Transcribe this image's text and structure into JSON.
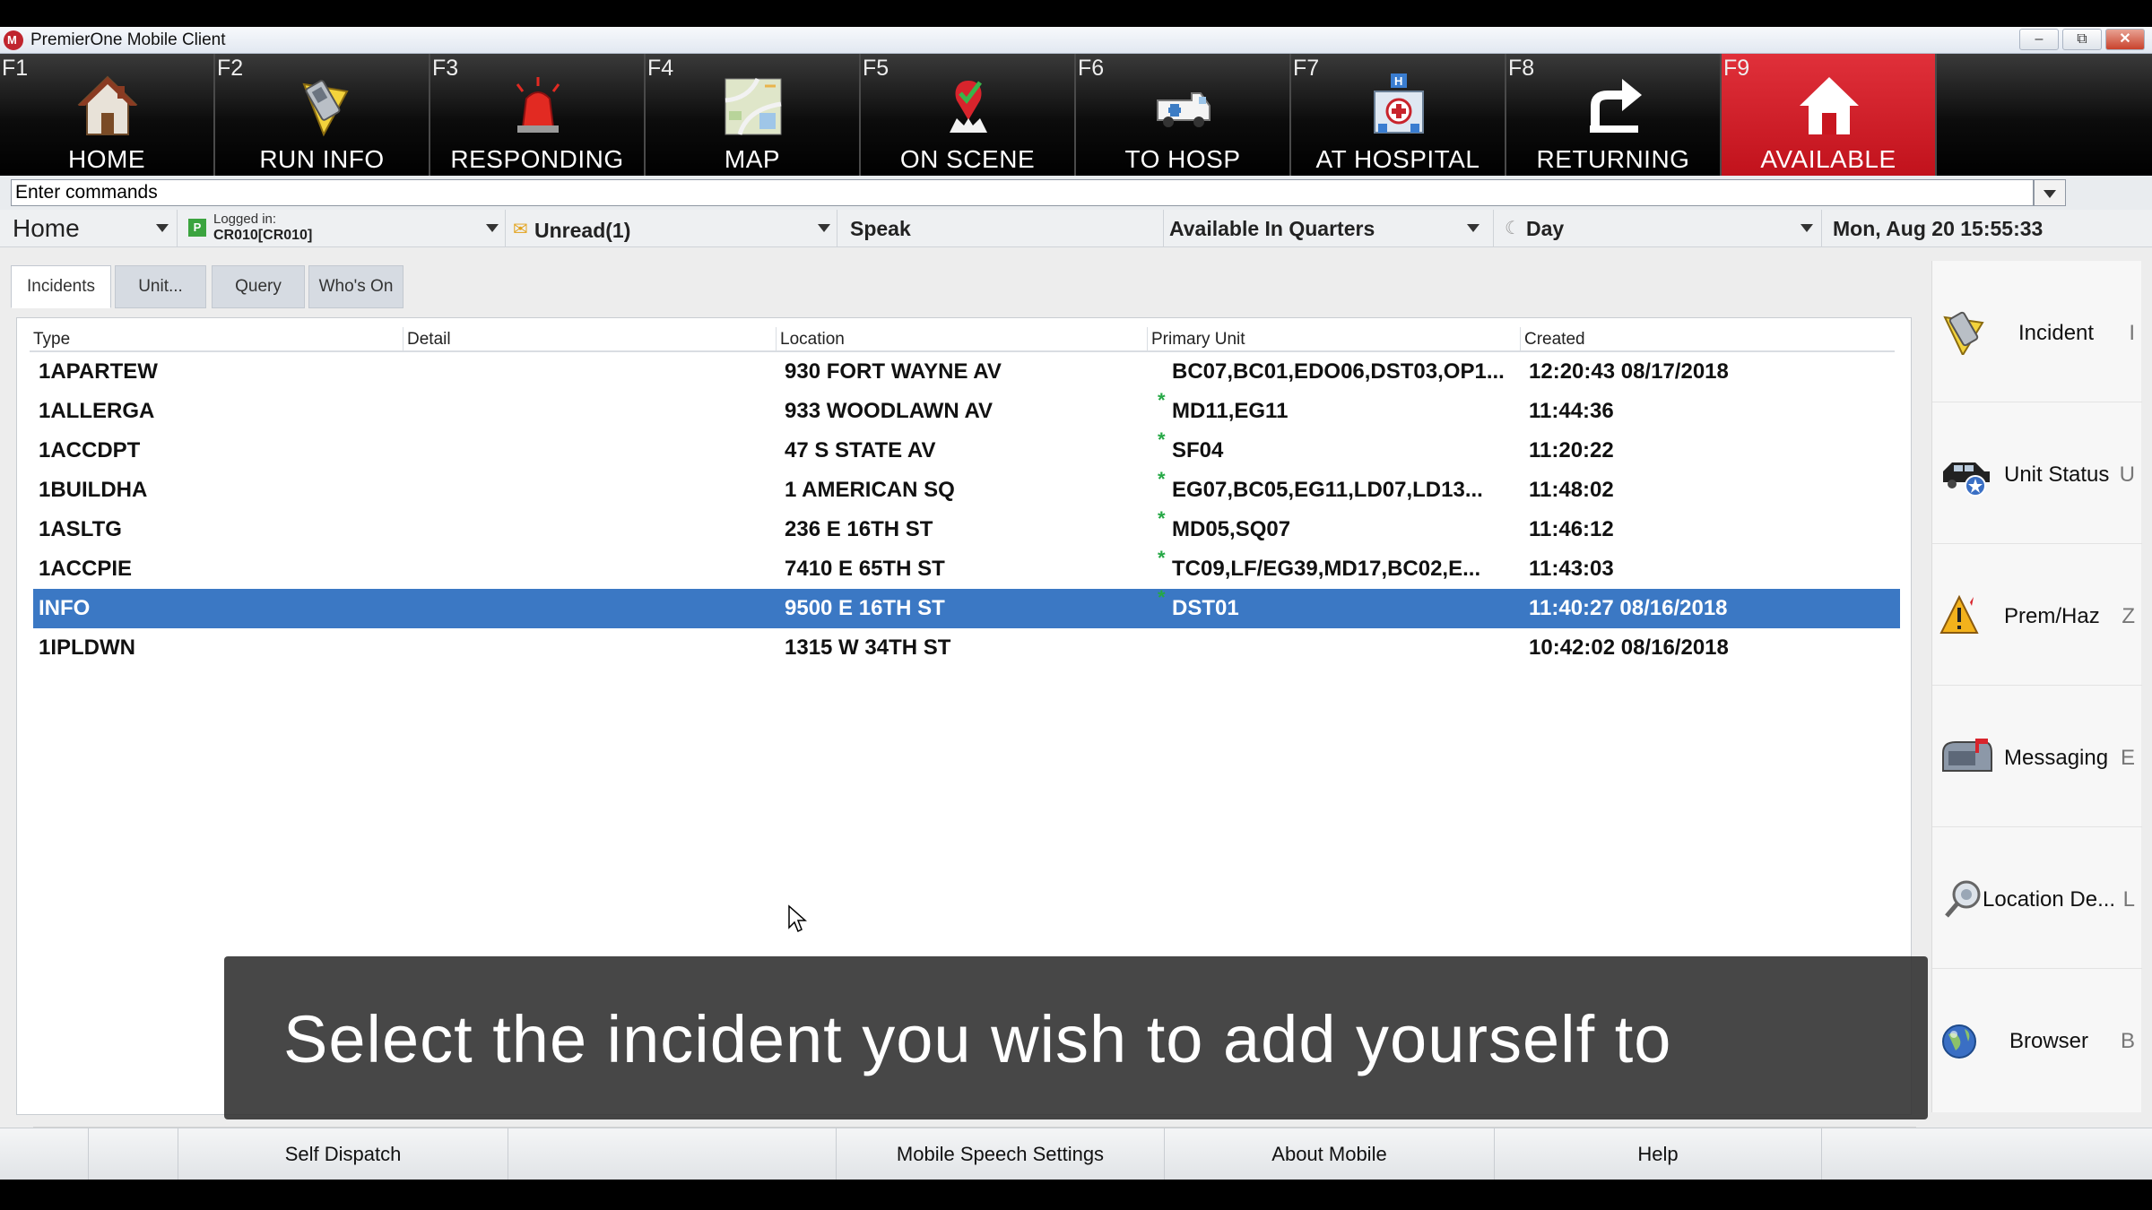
{
  "window": {
    "title": "PremierOne Mobile Client",
    "minimize": "–",
    "restore": "⧉",
    "close": "✕"
  },
  "toolbar": {
    "buttons": [
      {
        "key": "F1",
        "label": "HOME",
        "icon": "home-icon"
      },
      {
        "key": "F2",
        "label": "RUN INFO",
        "icon": "run-info-icon"
      },
      {
        "key": "F3",
        "label": "RESPONDING",
        "icon": "siren-icon"
      },
      {
        "key": "F4",
        "label": "MAP",
        "icon": "map-icon"
      },
      {
        "key": "F5",
        "label": "ON SCENE",
        "icon": "on-scene-icon"
      },
      {
        "key": "F6",
        "label": "TO HOSP",
        "icon": "ambulance-icon"
      },
      {
        "key": "F7",
        "label": "AT HOSPITAL",
        "icon": "hospital-icon"
      },
      {
        "key": "F8",
        "label": "RETURNING",
        "icon": "return-arrow-icon"
      },
      {
        "key": "F9",
        "label": "AVAILABLE",
        "icon": "available-home-icon"
      }
    ],
    "active_color": "#c8161f"
  },
  "command": {
    "value": "Enter commands"
  },
  "status": {
    "view": "Home",
    "logged_in_label": "Logged in:",
    "logged_in_user": "CR010[CR010]",
    "unread": "Unread(1)",
    "speak": "Speak",
    "unit_status": "Available In Quarters",
    "shift": "Day",
    "datetime": "Mon, Aug 20 15:55:33"
  },
  "tabs": [
    "Incidents",
    "Unit...",
    "Query",
    "Who's On"
  ],
  "table": {
    "columns": [
      "Type",
      "Detail",
      "Location",
      "Primary Unit",
      "Created"
    ],
    "rows": [
      {
        "type": "1APARTEW",
        "detail": "",
        "location": "930 FORT WAYNE AV",
        "primary_unit": "BC07,BC01,EDO06,DST03,OP1...",
        "created": "12:20:43 08/17/2018",
        "star": false
      },
      {
        "type": "1ALLERGA",
        "detail": "",
        "location": "933 WOODLAWN AV",
        "primary_unit": "MD11,EG11",
        "created": "11:44:36",
        "star": true
      },
      {
        "type": "1ACCDPT",
        "detail": "",
        "location": "47 S STATE AV",
        "primary_unit": "SF04",
        "created": "11:20:22",
        "star": true
      },
      {
        "type": "1BUILDHA",
        "detail": "",
        "location": "1 AMERICAN SQ",
        "primary_unit": "EG07,BC05,EG11,LD07,LD13...",
        "created": "11:48:02",
        "star": true
      },
      {
        "type": "1ASLTG",
        "detail": "",
        "location": "236 E 16TH ST",
        "primary_unit": "MD05,SQ07",
        "created": "11:46:12",
        "star": true
      },
      {
        "type": "1ACCPIE",
        "detail": "",
        "location": "7410 E 65TH ST",
        "primary_unit": "TC09,LF/EG39,MD17,BC02,E...",
        "created": "11:43:03",
        "star": true
      },
      {
        "type": "INFO",
        "detail": "",
        "location": "9500 E 16TH ST",
        "primary_unit": "DST01",
        "created": "11:40:27 08/16/2018",
        "star": true,
        "selected": true
      },
      {
        "type": "1IPLDWN",
        "detail": "",
        "location": "1315 W 34TH ST",
        "primary_unit": "",
        "created": "10:42:02 08/16/2018",
        "star": false
      }
    ],
    "selected_color": "#3b78c4",
    "star_symbol": "*"
  },
  "sidebar": {
    "items": [
      {
        "label": "Incident",
        "key": "I",
        "icon": "incident-icon"
      },
      {
        "label": "Unit Status",
        "key": "U",
        "icon": "unit-status-icon"
      },
      {
        "label": "Prem/Haz",
        "key": "Z",
        "icon": "hazard-icon"
      },
      {
        "label": "Messaging",
        "key": "E",
        "icon": "mailbox-icon"
      },
      {
        "label": "Location De...",
        "key": "L",
        "icon": "location-search-icon"
      },
      {
        "label": "Browser",
        "key": "B",
        "icon": "globe-icon"
      }
    ]
  },
  "overlay": {
    "text": "Select the incident you wish to add yourself to"
  },
  "bottom": {
    "buttons": [
      "Self Dispatch",
      "Mobile Speech Settings",
      "About Mobile",
      "Help"
    ]
  }
}
